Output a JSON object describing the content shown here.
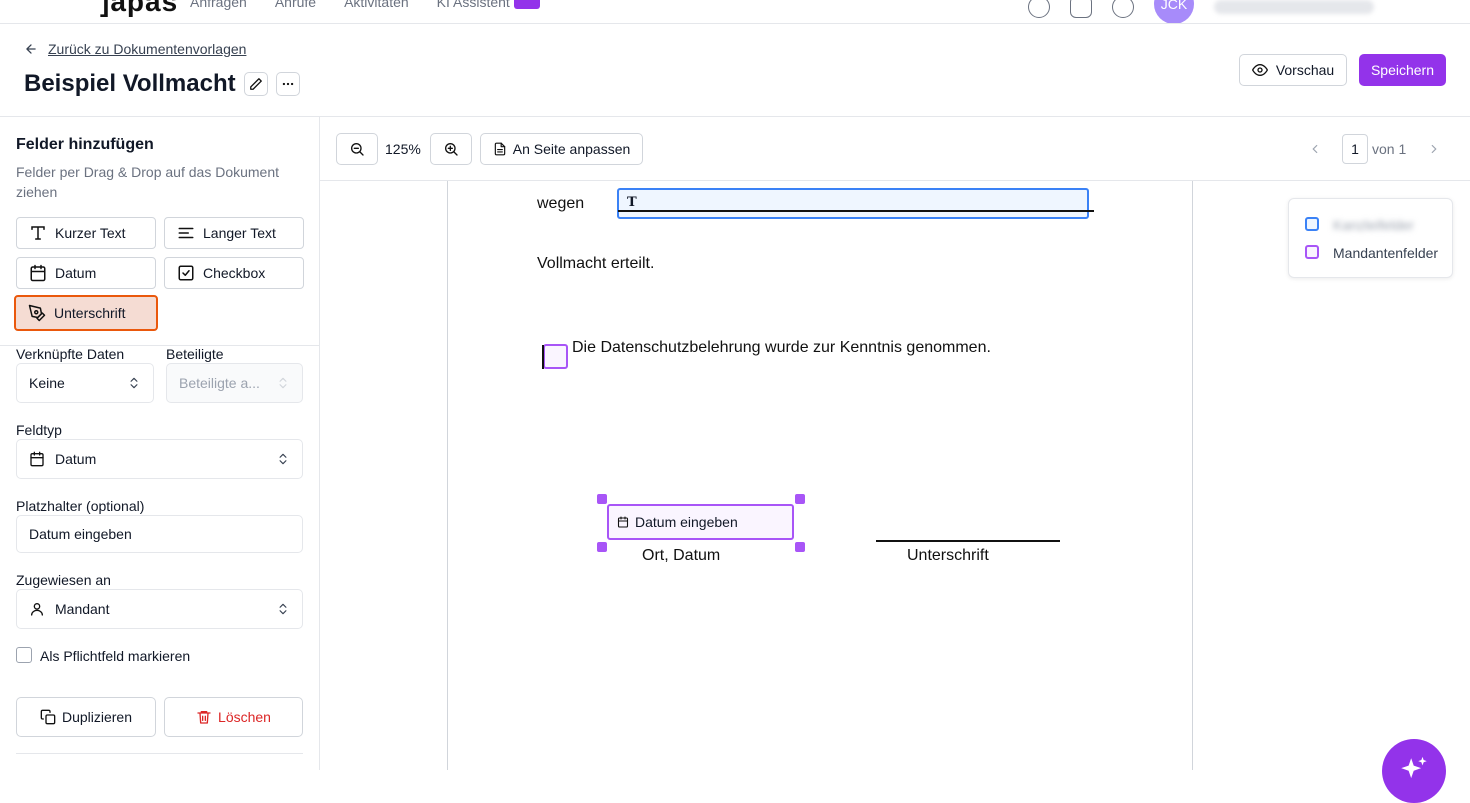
{
  "topnav": {
    "logo": "]apas",
    "links": [
      "Anfragen",
      "Anrufe",
      "Aktivitäten",
      "KI Assistent"
    ],
    "avatar_initials": "JCK"
  },
  "header": {
    "back_link": "Zurück zu Dokumentenvorlagen",
    "title": "Beispiel Vollmacht",
    "preview_label": "Vorschau",
    "save_label": "Speichern"
  },
  "sidebar": {
    "title": "Felder hinzufügen",
    "description": "Felder per Drag & Drop auf das Dokument ziehen",
    "field_buttons": [
      "Kurzer Text",
      "Langer Text",
      "Datum",
      "Checkbox",
      "Unterschrift"
    ],
    "linked_data_label": "Verknüpfte Daten",
    "linked_data_value": "Keine",
    "participants_label": "Beteiligte",
    "participants_placeholder": "Beteiligte a...",
    "field_type_label": "Feldtyp",
    "field_type_value": "Datum",
    "placeholder_label": "Platzhalter (optional)",
    "placeholder_value": "Datum eingeben",
    "assigned_label": "Zugewiesen an",
    "assigned_value": "Mandant",
    "required_label": "Als Pflichtfeld markieren",
    "duplicate_label": "Duplizieren",
    "delete_label": "Löschen"
  },
  "toolbar": {
    "zoom": "125%",
    "fit_label": "An Seite anpassen",
    "page_current": "1",
    "page_of": "von 1"
  },
  "document": {
    "wegen": "wegen",
    "vollmacht": "Vollmacht erteilt.",
    "datenschutz": "Die Datenschutzbelehrung wurde zur Kenntnis genommen.",
    "date_field_placeholder": "Datum eingeben",
    "ort_datum": "Ort, Datum",
    "unterschrift": "Unterschrift",
    "text_field_glyph": "T"
  },
  "legend": {
    "items": [
      "Kanzleifelder",
      "Mandantenfelder"
    ]
  },
  "colors": {
    "brand": "#9333ea",
    "kanzlei": "#3b82f6",
    "mandant": "#a855f7",
    "active_field": "#ea580c"
  }
}
